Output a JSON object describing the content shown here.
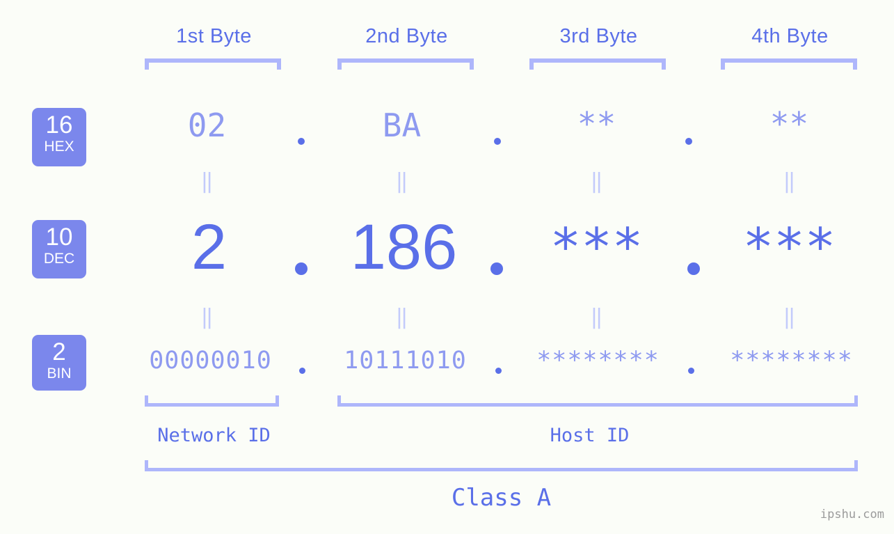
{
  "page": {
    "background_color": "#fbfdf8",
    "accent_color": "#5a6fe8",
    "accent_light_color": "#8e9af0",
    "bracket_color": "#aeb6fb",
    "badge_color": "#7b87ec",
    "connector_color": "#c3cbfb",
    "watermark": "ipshu.com"
  },
  "byte_headers": [
    {
      "label": "1st Byte"
    },
    {
      "label": "2nd Byte"
    },
    {
      "label": "3rd Byte"
    },
    {
      "label": "4th Byte"
    }
  ],
  "rows": [
    {
      "base_number": "16",
      "base_name": "HEX",
      "values": [
        "02",
        "BA",
        "**",
        "**"
      ],
      "separator": "."
    },
    {
      "base_number": "10",
      "base_name": "DEC",
      "values": [
        "2",
        "186",
        "***",
        "***"
      ],
      "separator": "."
    },
    {
      "base_number": "2",
      "base_name": "BIN",
      "values": [
        "00000010",
        "10111010",
        "********",
        "********"
      ],
      "separator": "."
    }
  ],
  "connector_symbol": "‖",
  "sections": {
    "network_id": "Network ID",
    "host_id": "Host ID",
    "class": "Class A"
  }
}
